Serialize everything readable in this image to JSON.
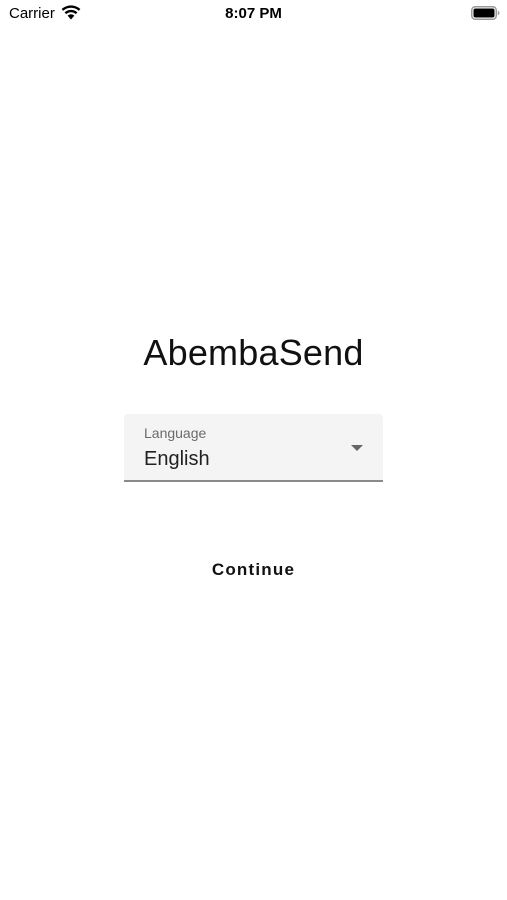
{
  "status_bar": {
    "carrier": "Carrier",
    "time": "8:07 PM",
    "icons": [
      "wifi-icon",
      "battery-icon"
    ]
  },
  "main": {
    "app_title": "AbembaSend",
    "language_select": {
      "label": "Language",
      "value": "English",
      "icon": "chevron-down-icon"
    },
    "continue_label": "Continue"
  },
  "colors": {
    "background": "#ffffff",
    "field_background": "#f4f4f4",
    "field_underline": "#8a8a8a",
    "label_text": "#6b6b6b"
  }
}
